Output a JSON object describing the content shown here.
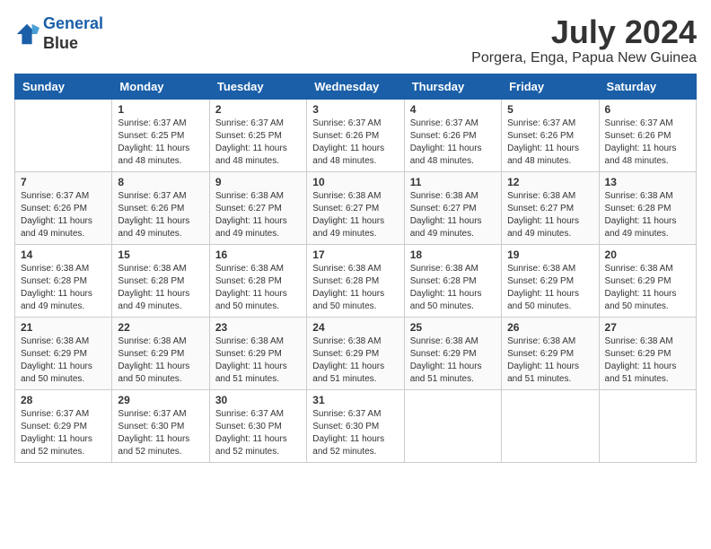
{
  "logo": {
    "line1": "General",
    "line2": "Blue"
  },
  "title": "July 2024",
  "location": "Porgera, Enga, Papua New Guinea",
  "days": [
    "Sunday",
    "Monday",
    "Tuesday",
    "Wednesday",
    "Thursday",
    "Friday",
    "Saturday"
  ],
  "weeks": [
    [
      {
        "date": "",
        "info": ""
      },
      {
        "date": "1",
        "info": "Sunrise: 6:37 AM\nSunset: 6:25 PM\nDaylight: 11 hours\nand 48 minutes."
      },
      {
        "date": "2",
        "info": "Sunrise: 6:37 AM\nSunset: 6:25 PM\nDaylight: 11 hours\nand 48 minutes."
      },
      {
        "date": "3",
        "info": "Sunrise: 6:37 AM\nSunset: 6:26 PM\nDaylight: 11 hours\nand 48 minutes."
      },
      {
        "date": "4",
        "info": "Sunrise: 6:37 AM\nSunset: 6:26 PM\nDaylight: 11 hours\nand 48 minutes."
      },
      {
        "date": "5",
        "info": "Sunrise: 6:37 AM\nSunset: 6:26 PM\nDaylight: 11 hours\nand 48 minutes."
      },
      {
        "date": "6",
        "info": "Sunrise: 6:37 AM\nSunset: 6:26 PM\nDaylight: 11 hours\nand 48 minutes."
      }
    ],
    [
      {
        "date": "7",
        "info": "Sunrise: 6:37 AM\nSunset: 6:26 PM\nDaylight: 11 hours\nand 49 minutes."
      },
      {
        "date": "8",
        "info": "Sunrise: 6:37 AM\nSunset: 6:26 PM\nDaylight: 11 hours\nand 49 minutes."
      },
      {
        "date": "9",
        "info": "Sunrise: 6:38 AM\nSunset: 6:27 PM\nDaylight: 11 hours\nand 49 minutes."
      },
      {
        "date": "10",
        "info": "Sunrise: 6:38 AM\nSunset: 6:27 PM\nDaylight: 11 hours\nand 49 minutes."
      },
      {
        "date": "11",
        "info": "Sunrise: 6:38 AM\nSunset: 6:27 PM\nDaylight: 11 hours\nand 49 minutes."
      },
      {
        "date": "12",
        "info": "Sunrise: 6:38 AM\nSunset: 6:27 PM\nDaylight: 11 hours\nand 49 minutes."
      },
      {
        "date": "13",
        "info": "Sunrise: 6:38 AM\nSunset: 6:28 PM\nDaylight: 11 hours\nand 49 minutes."
      }
    ],
    [
      {
        "date": "14",
        "info": "Sunrise: 6:38 AM\nSunset: 6:28 PM\nDaylight: 11 hours\nand 49 minutes."
      },
      {
        "date": "15",
        "info": "Sunrise: 6:38 AM\nSunset: 6:28 PM\nDaylight: 11 hours\nand 49 minutes."
      },
      {
        "date": "16",
        "info": "Sunrise: 6:38 AM\nSunset: 6:28 PM\nDaylight: 11 hours\nand 50 minutes."
      },
      {
        "date": "17",
        "info": "Sunrise: 6:38 AM\nSunset: 6:28 PM\nDaylight: 11 hours\nand 50 minutes."
      },
      {
        "date": "18",
        "info": "Sunrise: 6:38 AM\nSunset: 6:28 PM\nDaylight: 11 hours\nand 50 minutes."
      },
      {
        "date": "19",
        "info": "Sunrise: 6:38 AM\nSunset: 6:29 PM\nDaylight: 11 hours\nand 50 minutes."
      },
      {
        "date": "20",
        "info": "Sunrise: 6:38 AM\nSunset: 6:29 PM\nDaylight: 11 hours\nand 50 minutes."
      }
    ],
    [
      {
        "date": "21",
        "info": "Sunrise: 6:38 AM\nSunset: 6:29 PM\nDaylight: 11 hours\nand 50 minutes."
      },
      {
        "date": "22",
        "info": "Sunrise: 6:38 AM\nSunset: 6:29 PM\nDaylight: 11 hours\nand 50 minutes."
      },
      {
        "date": "23",
        "info": "Sunrise: 6:38 AM\nSunset: 6:29 PM\nDaylight: 11 hours\nand 51 minutes."
      },
      {
        "date": "24",
        "info": "Sunrise: 6:38 AM\nSunset: 6:29 PM\nDaylight: 11 hours\nand 51 minutes."
      },
      {
        "date": "25",
        "info": "Sunrise: 6:38 AM\nSunset: 6:29 PM\nDaylight: 11 hours\nand 51 minutes."
      },
      {
        "date": "26",
        "info": "Sunrise: 6:38 AM\nSunset: 6:29 PM\nDaylight: 11 hours\nand 51 minutes."
      },
      {
        "date": "27",
        "info": "Sunrise: 6:38 AM\nSunset: 6:29 PM\nDaylight: 11 hours\nand 51 minutes."
      }
    ],
    [
      {
        "date": "28",
        "info": "Sunrise: 6:37 AM\nSunset: 6:29 PM\nDaylight: 11 hours\nand 52 minutes."
      },
      {
        "date": "29",
        "info": "Sunrise: 6:37 AM\nSunset: 6:30 PM\nDaylight: 11 hours\nand 52 minutes."
      },
      {
        "date": "30",
        "info": "Sunrise: 6:37 AM\nSunset: 6:30 PM\nDaylight: 11 hours\nand 52 minutes."
      },
      {
        "date": "31",
        "info": "Sunrise: 6:37 AM\nSunset: 6:30 PM\nDaylight: 11 hours\nand 52 minutes."
      },
      {
        "date": "",
        "info": ""
      },
      {
        "date": "",
        "info": ""
      },
      {
        "date": "",
        "info": ""
      }
    ]
  ]
}
